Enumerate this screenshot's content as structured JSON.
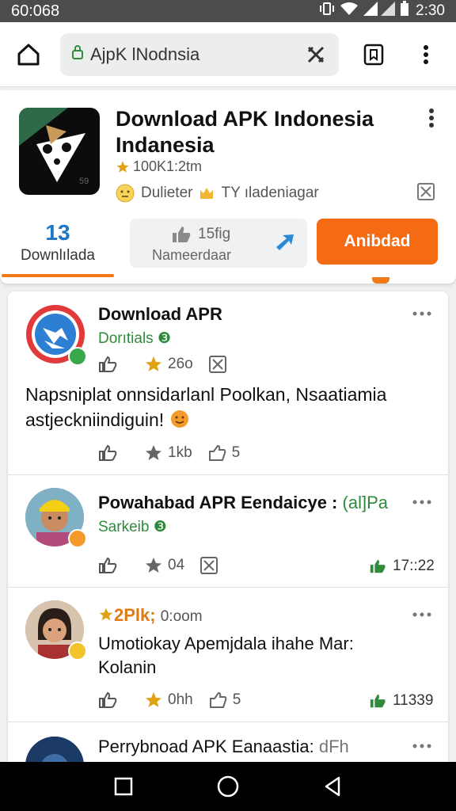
{
  "status_bar": {
    "time_left": "60:068",
    "time_right": "2:30"
  },
  "browser": {
    "url": "AjpK lNodnsia"
  },
  "app": {
    "title": "Download APK Indonesia Indanesia",
    "rating": "100K1:2tm",
    "info_left": "Dulieter",
    "info_right": "TY ıladeniagar",
    "downloads_count": "13",
    "downloads_label": "Downlılada",
    "mid_value": "15fig",
    "mid_label": "Nameerdaar",
    "action_label": "Anibdad"
  },
  "posts": [
    {
      "title": "Download APR",
      "subtitle": "Dorıtials",
      "stat_star": "26o",
      "body": "Napsniplat onnsidarlanl Poolkan, Nsaatiamia astjeckniindiguin!",
      "bottom_star": "1kb",
      "bottom_share": "5"
    },
    {
      "title": "Powahabad APR Eendaicye :",
      "title_accent": "(al]Pa",
      "subtitle": "Sarkeib",
      "stat_star": "04",
      "likes": "17::22"
    },
    {
      "title": "2Plk;",
      "time": "0:oom",
      "body": "Umotiokay Apemjdala ihahe Mar: Kolanin",
      "stat_star": "0hh",
      "share": "5",
      "likes": "11339"
    },
    {
      "title": "Perrybnoad APK Eanaastia:",
      "title_accent": "dFh"
    }
  ],
  "colors": {
    "accent_orange": "#f46b13",
    "link_blue": "#1e76c8",
    "green": "#2f8a3c",
    "star": "#e0a214"
  },
  "icons": [
    "home-icon",
    "lock-icon",
    "close-icon",
    "bookmark-icon",
    "more-vert-icon",
    "star-icon",
    "thumb-up-icon",
    "share-icon",
    "image-icon",
    "arrow-icon",
    "nav-square-icon",
    "nav-circle-icon",
    "nav-back-icon"
  ]
}
